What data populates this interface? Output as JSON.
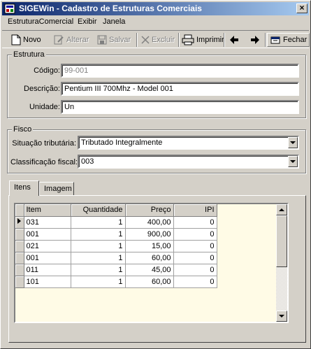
{
  "window": {
    "title": "SIGEWin - Cadastro de Estruturas Comerciais",
    "close_label": "×"
  },
  "menu": [
    "EstruturaComercial",
    "Exibir",
    "Janela"
  ],
  "toolbar": {
    "novo": "Novo",
    "alterar": "Alterar",
    "salvar": "Salvar",
    "excluir": "Excluir",
    "imprimir": "Imprimir",
    "fechar": "Fechar"
  },
  "estrutura": {
    "group_label": "Estrutura",
    "codigo_label": "Código:",
    "codigo_value": "99-001",
    "descricao_label": "Descrição:",
    "descricao_value": "Pentium III 700Mhz - Model 001",
    "unidade_label": "Unidade:",
    "unidade_value": "Un"
  },
  "fisco": {
    "group_label": "Fisco",
    "situacao_label": "Situação tributária:",
    "situacao_value": "Tributado Integralmente",
    "classificacao_label": "Classificação fiscal:",
    "classificacao_value": "003"
  },
  "tabs": [
    "Itens",
    "Imagem"
  ],
  "grid": {
    "columns": [
      "Item",
      "Quantidade",
      "Preço",
      "IPI"
    ],
    "rows": [
      [
        "031",
        "1",
        "400,00",
        "0"
      ],
      [
        "001",
        "1",
        "900,00",
        "0"
      ],
      [
        "021",
        "1",
        "15,00",
        "0"
      ],
      [
        "001",
        "1",
        "60,00",
        "0"
      ],
      [
        "011",
        "1",
        "45,00",
        "0"
      ],
      [
        "101",
        "1",
        "60,00",
        "0"
      ]
    ]
  }
}
